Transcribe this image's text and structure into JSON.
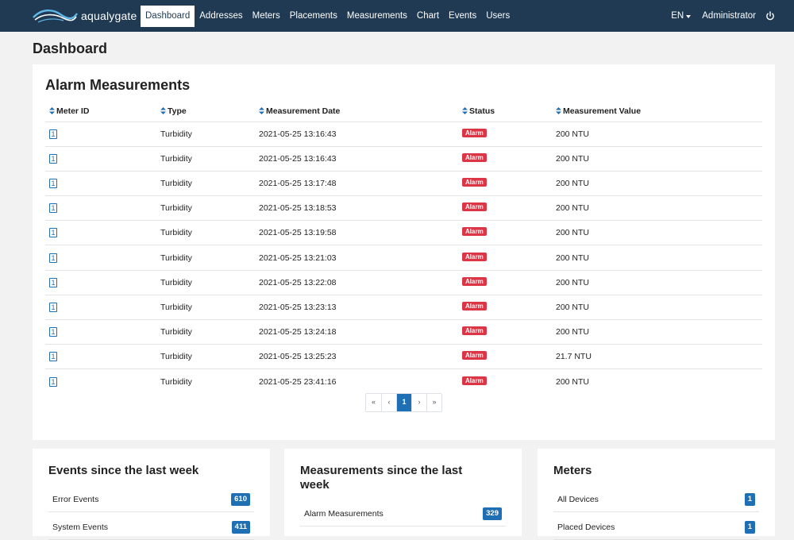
{
  "nav": {
    "brand": "aqualygate",
    "items": [
      {
        "label": "Dashboard",
        "active": true
      },
      {
        "label": "Addresses",
        "active": false
      },
      {
        "label": "Meters",
        "active": false
      },
      {
        "label": "Placements",
        "active": false
      },
      {
        "label": "Measurements",
        "active": false
      },
      {
        "label": "Chart",
        "active": false
      },
      {
        "label": "Events",
        "active": false
      },
      {
        "label": "Users",
        "active": false
      }
    ],
    "language": "EN",
    "user": "Administrator",
    "logout_icon": "power-icon"
  },
  "page": {
    "title": "Dashboard"
  },
  "alarm_card": {
    "title": "Alarm Measurements",
    "columns": [
      "Meter ID",
      "Type",
      "Measurement Date",
      "Status",
      "Measurement Value"
    ],
    "rows": [
      {
        "meter_id": "1",
        "type": "Turbidity",
        "date": "2021-05-25 13:16:43",
        "status": "Alarm",
        "value": "200 NTU"
      },
      {
        "meter_id": "1",
        "type": "Turbidity",
        "date": "2021-05-25 13:16:43",
        "status": "Alarm",
        "value": "200 NTU"
      },
      {
        "meter_id": "1",
        "type": "Turbidity",
        "date": "2021-05-25 13:17:48",
        "status": "Alarm",
        "value": "200 NTU"
      },
      {
        "meter_id": "1",
        "type": "Turbidity",
        "date": "2021-05-25 13:18:53",
        "status": "Alarm",
        "value": "200 NTU"
      },
      {
        "meter_id": "1",
        "type": "Turbidity",
        "date": "2021-05-25 13:19:58",
        "status": "Alarm",
        "value": "200 NTU"
      },
      {
        "meter_id": "1",
        "type": "Turbidity",
        "date": "2021-05-25 13:21:03",
        "status": "Alarm",
        "value": "200 NTU"
      },
      {
        "meter_id": "1",
        "type": "Turbidity",
        "date": "2021-05-25 13:22:08",
        "status": "Alarm",
        "value": "200 NTU"
      },
      {
        "meter_id": "1",
        "type": "Turbidity",
        "date": "2021-05-25 13:23:13",
        "status": "Alarm",
        "value": "200 NTU"
      },
      {
        "meter_id": "1",
        "type": "Turbidity",
        "date": "2021-05-25 13:24:18",
        "status": "Alarm",
        "value": "200 NTU"
      },
      {
        "meter_id": "1",
        "type": "Turbidity",
        "date": "2021-05-25 13:25:23",
        "status": "Alarm",
        "value": "21.7 NTU"
      },
      {
        "meter_id": "1",
        "type": "Turbidity",
        "date": "2021-05-25 23:41:16",
        "status": "Alarm",
        "value": "200 NTU"
      }
    ],
    "pagination": [
      "«",
      "‹",
      "1",
      "›",
      "»"
    ],
    "current_page": "1"
  },
  "events_card": {
    "title": "Events since the last week",
    "rows": [
      {
        "label": "Error Events",
        "count": "610"
      },
      {
        "label": "System Events",
        "count": "411"
      }
    ]
  },
  "measurements_card": {
    "title": "Measurements since the last week",
    "rows": [
      {
        "label": "Alarm Measurements",
        "count": "329"
      }
    ]
  },
  "meters_card": {
    "title": "Meters",
    "rows": [
      {
        "label": "All Devices",
        "count": "1"
      },
      {
        "label": "Placed Devices",
        "count": "1"
      }
    ]
  },
  "colors": {
    "navbar": "#1f3a52",
    "primary": "#1f6fb5",
    "alarm": "#dc3545",
    "background": "#f2f2f2"
  }
}
